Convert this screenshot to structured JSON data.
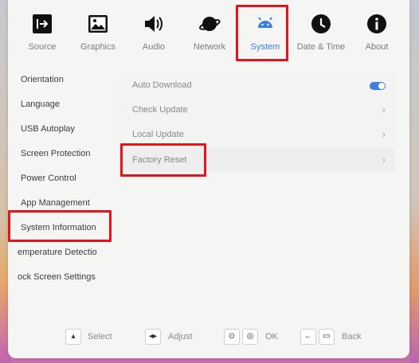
{
  "top_nav": [
    {
      "label": "Source",
      "icon": "source-icon",
      "selected": false
    },
    {
      "label": "Graphics",
      "icon": "graphics-icon",
      "selected": false
    },
    {
      "label": "Audio",
      "icon": "speaker-icon",
      "selected": false
    },
    {
      "label": "Network",
      "icon": "planet-icon",
      "selected": false
    },
    {
      "label": "System",
      "icon": "android-icon",
      "selected": true
    },
    {
      "label": "Date & Time",
      "icon": "clock-icon",
      "selected": false
    },
    {
      "label": "About",
      "icon": "info-icon",
      "selected": false
    }
  ],
  "sidebar": [
    {
      "label": "Orientation"
    },
    {
      "label": "Language"
    },
    {
      "label": "USB Autoplay"
    },
    {
      "label": "Screen Protection"
    },
    {
      "label": "Power Control"
    },
    {
      "label": "App Management"
    },
    {
      "label": "System Information"
    },
    {
      "label": "emperature Detectio"
    },
    {
      "label": "ock Screen Settings"
    }
  ],
  "content": {
    "rows": [
      {
        "label": "Auto Download",
        "control": "toggle",
        "value": true
      },
      {
        "label": "Check Update",
        "control": "chevron"
      },
      {
        "label": "Local Update",
        "control": "chevron"
      },
      {
        "label": "Factory Reset",
        "control": "chevron"
      }
    ]
  },
  "bottom_hints": [
    {
      "label": "Select",
      "key": "up-down-key-icon"
    },
    {
      "label": "Adjust",
      "key": "left-right-key-icon"
    },
    {
      "label": "OK",
      "key": "ok-key-icon"
    },
    {
      "label": "Back",
      "key": "back-key-icon"
    }
  ],
  "colors": {
    "highlight": "#e5141c",
    "accent": "#3a7fe0"
  }
}
